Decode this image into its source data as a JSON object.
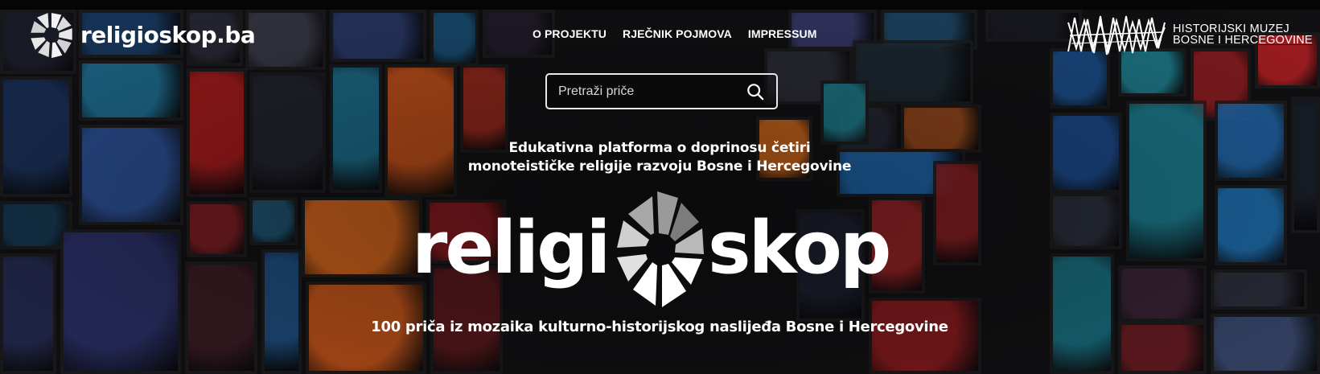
{
  "site": {
    "logo_text": "religioskop.ba",
    "logo_icon": "religioskop-emblem-icon"
  },
  "nav": {
    "items": [
      {
        "label": "O PROJEKTU"
      },
      {
        "label": "RJEČNIK POJMOVA"
      },
      {
        "label": "IMPRESSUM"
      }
    ]
  },
  "partner": {
    "line1": "HISTORIJSKI MUZEJ",
    "line2": "BOSNE I HERCEGOVINE",
    "icon": "museum-lattice-icon"
  },
  "search": {
    "placeholder": "Pretraži priče",
    "value": "",
    "icon": "search-icon"
  },
  "hero": {
    "tagline_line1": "Edukativna platforma o doprinosu četiri",
    "tagline_line2": "monoteističke religije razvoju Bosne i Hercegovine",
    "title_left": "religi",
    "title_right": "skop",
    "subtitle": "100 priča iz mozaika kulturno-historijskog naslijeđa Bosne i Hercegovine"
  },
  "colors": {
    "text": "#ffffff",
    "background": "#101012",
    "glass_blue": "#1f6fb0",
    "glass_teal": "#1e7f8f",
    "glass_orange": "#d9621a",
    "glass_red": "#a21f22"
  }
}
